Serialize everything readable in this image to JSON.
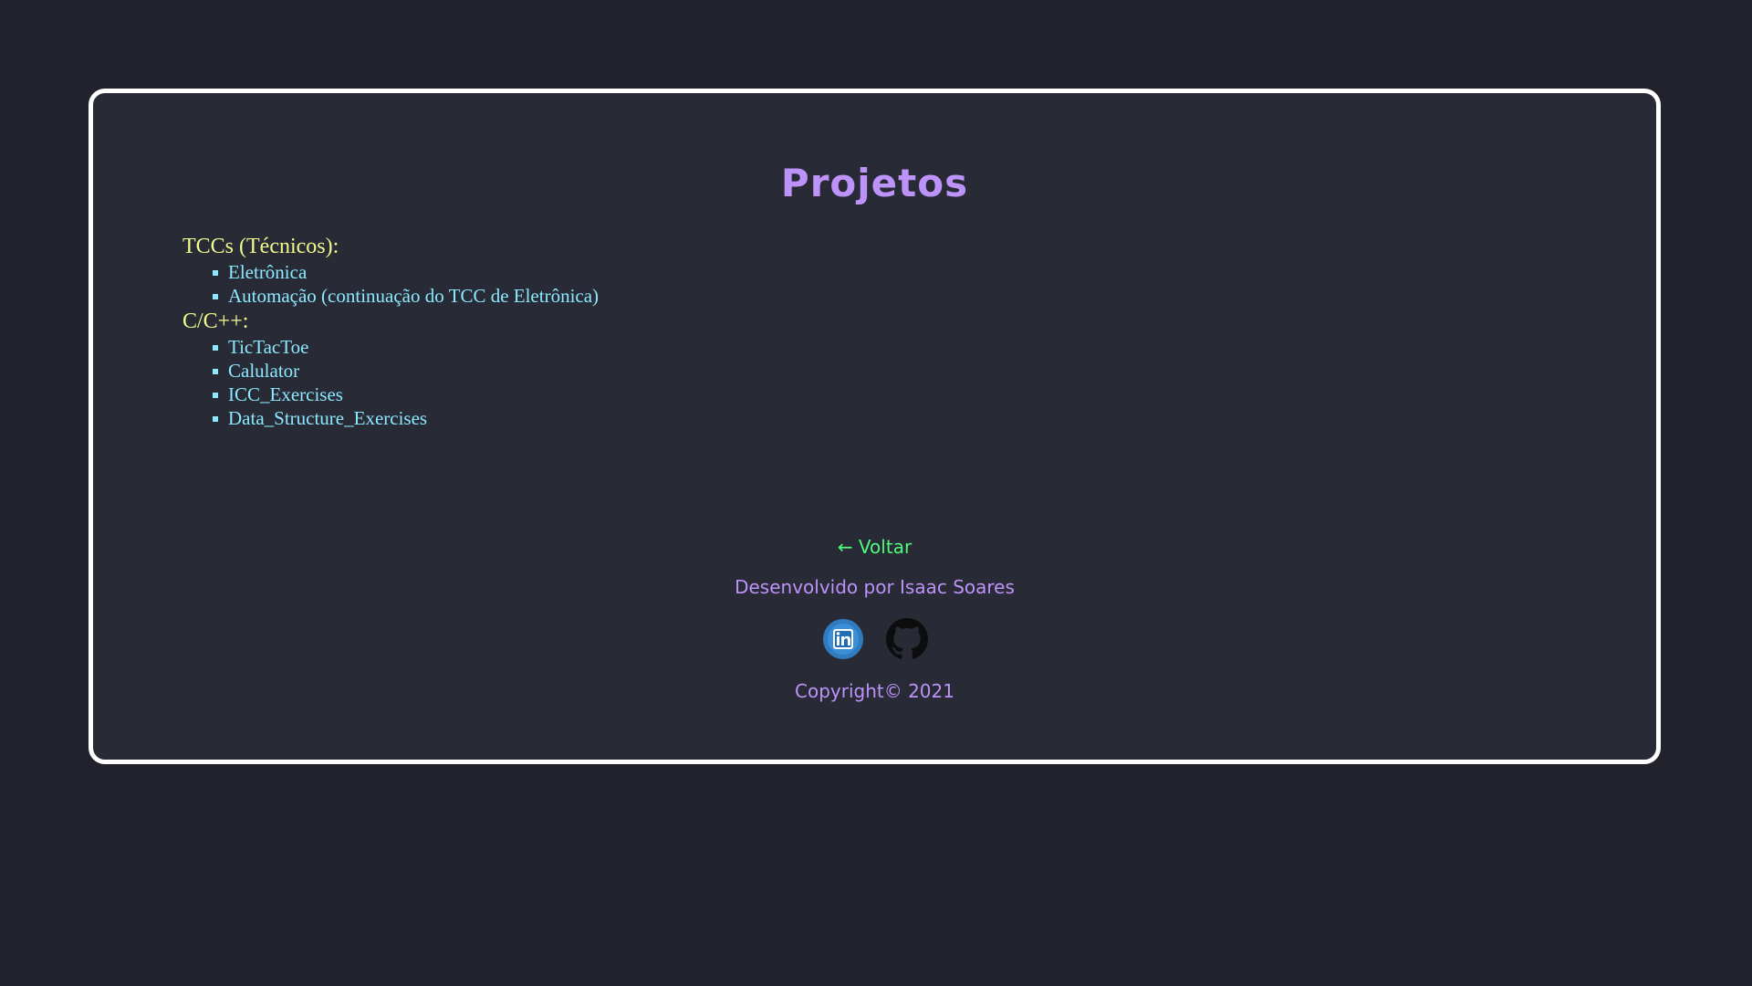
{
  "page": {
    "title": "Projetos"
  },
  "categories": [
    {
      "title": "TCCs (Técnicos):",
      "items": [
        "Eletrônica",
        "Automação (continuação do TCC de Eletrônica)"
      ]
    },
    {
      "title": "C/C++:",
      "items": [
        "TicTacToe",
        "Calulator",
        "ICC_Exercises",
        "Data_Structure_Exercises"
      ]
    }
  ],
  "footer": {
    "back_label": "← Voltar",
    "credits": "Desenvolvido por Isaac Soares",
    "copyright": "Copyright© 2021",
    "social": [
      {
        "icon": "linkedin-icon"
      },
      {
        "icon": "github-icon"
      }
    ]
  },
  "colors": {
    "background": "#21222c",
    "card": "#282a36",
    "border": "#ffffff",
    "title": "#bd93f9",
    "category": "#f1fa8c",
    "link": "#8be9fd",
    "back": "#50fa7b",
    "linkedin": "#2e7bbf"
  }
}
